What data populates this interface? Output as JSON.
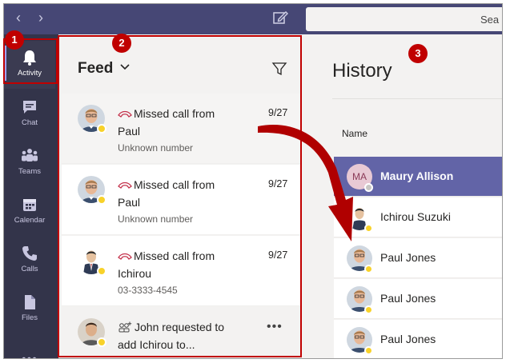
{
  "topbar": {
    "back_icon": "chevron-left-icon",
    "forward_icon": "chevron-right-icon",
    "compose_icon": "compose-icon",
    "search_text": "Sea"
  },
  "rail": {
    "items": [
      {
        "label": "Activity",
        "icon": "bell-icon",
        "active": true
      },
      {
        "label": "Chat",
        "icon": "chat-icon"
      },
      {
        "label": "Teams",
        "icon": "teams-icon"
      },
      {
        "label": "Calendar",
        "icon": "calendar-icon"
      },
      {
        "label": "Calls",
        "icon": "phone-icon"
      },
      {
        "label": "Files",
        "icon": "file-icon"
      }
    ],
    "more": "•••"
  },
  "feed": {
    "title": "Feed",
    "items": [
      {
        "title": "Missed call from Paul",
        "subtitle": "Unknown number",
        "date": "9/27",
        "icon": "missed-call-icon",
        "avatar": "paul-avatar"
      },
      {
        "title": "Missed call from Paul",
        "subtitle": "Unknown number",
        "date": "9/27",
        "icon": "missed-call-icon",
        "avatar": "paul-avatar"
      },
      {
        "title": "Missed call from Ichirou",
        "subtitle": "03-3333-4545",
        "date": "9/27",
        "icon": "missed-call-icon",
        "avatar": "ichirou-avatar"
      },
      {
        "title": "John requested to add Ichirou to...",
        "subtitle": "",
        "date": "",
        "icon": "add-people-icon",
        "avatar": "john-avatar",
        "more": "•••"
      }
    ]
  },
  "history": {
    "title": "History",
    "column_name": "Name",
    "rows": [
      {
        "name": "Maury Allison",
        "initials": "MA",
        "selected": true
      },
      {
        "name": "Ichirou Suzuki"
      },
      {
        "name": "Paul Jones"
      },
      {
        "name": "Paul Jones"
      },
      {
        "name": "Paul Jones"
      }
    ]
  },
  "annotations": {
    "badges": [
      "1",
      "2",
      "3"
    ],
    "color": "#c00000"
  },
  "colors": {
    "topbar": "#464775",
    "rail": "#33344a",
    "accent": "#6264a7",
    "status_away": "#f8d22a"
  }
}
